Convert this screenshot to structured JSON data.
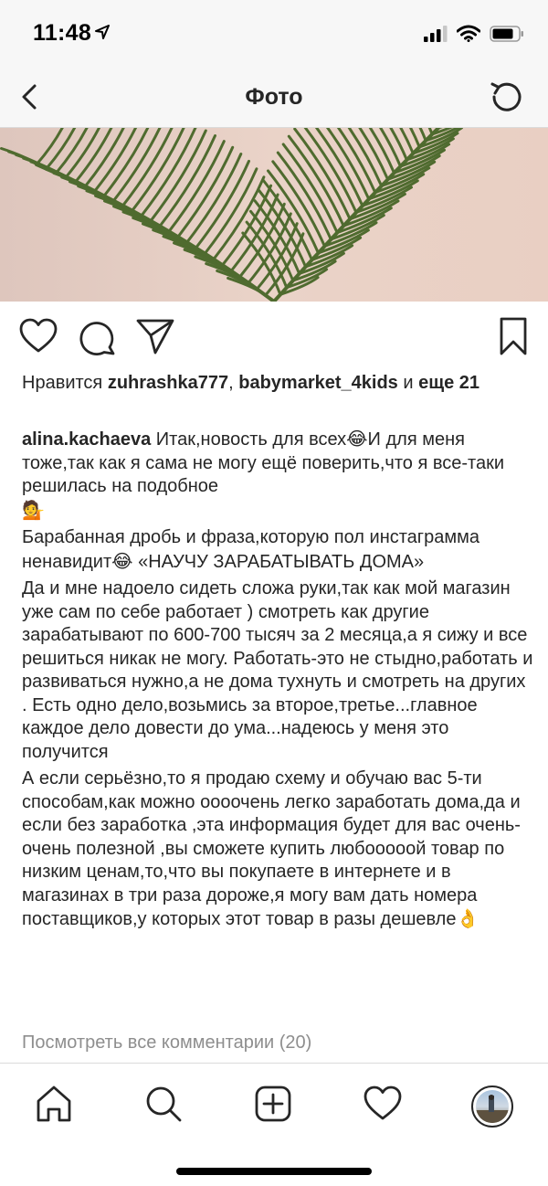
{
  "status_bar": {
    "time": "11:48"
  },
  "nav": {
    "title": "Фото",
    "back_icon": "chevron-left-icon",
    "refresh_icon": "refresh-icon"
  },
  "actions": {
    "like_icon": "heart-icon",
    "comment_icon": "comment-icon",
    "share_icon": "send-icon",
    "save_icon": "bookmark-icon"
  },
  "likes": {
    "prefix": "Нравится",
    "user1": "zuhrashka777",
    "separator": ",",
    "user2": "babymarket_4kids",
    "and": "и",
    "more": "еще 21"
  },
  "caption": {
    "username": "alina.kachaeva",
    "p1_a": "Итак,новость для всех",
    "p1_emoji1": "😂",
    "p1_b": "И для меня тоже,так как я сама не могу ещё поверить,что я все-таки решилась на подобное",
    "p1_emoji2": "💁",
    "p2_a": "Барабанная дробь и фраза,которую пол инстаграмма ненавидит",
    "p2_emoji": "😂",
    "p2_b": " «НАУЧУ ЗАРАБАТЫВАТЬ ДОМА»",
    "p3": "Да и мне надоело сидеть сложа руки,так как мой магазин уже сам по себе работает ) смотреть как другие зарабатывают по 600-700 тысяч за 2 месяца,а я сижу и все решиться никак не могу. Работать-это не стыдно,работать и развиваться нужно,а не дома тухнуть и смотреть на других . Есть одно дело,возьмись за второе,третье...главное каждое дело довести до ума...надеюсь у меня это получится",
    "p4": "А если серьёзно,то я продаю схему и обучаю вас 5-ти способам,как можно оооочень легко заработать дома,да и если без заработка ,эта информация будет для вас очень-очень полезной ,вы сможете купить любооооой товар по низким ценам,то,что вы покупаете в интернете и в магазинах в три раза дороже,я могу вам дать номера поставщиков,у которых этот товар в разы дешевле",
    "p4_emoji": "👌"
  },
  "view_comments": "Посмотреть все комментарии (20)",
  "tab_bar": {
    "home_icon": "home-icon",
    "search_icon": "search-icon",
    "add_icon": "add-post-icon",
    "activity_icon": "heart-icon",
    "profile_icon": "profile-avatar"
  },
  "colors": {
    "text": "#262626",
    "muted": "#8e8e8e",
    "bar_bg": "#f7f7f7",
    "image_bg": "#e8cfc4",
    "leaf": "#4f6b2f"
  }
}
